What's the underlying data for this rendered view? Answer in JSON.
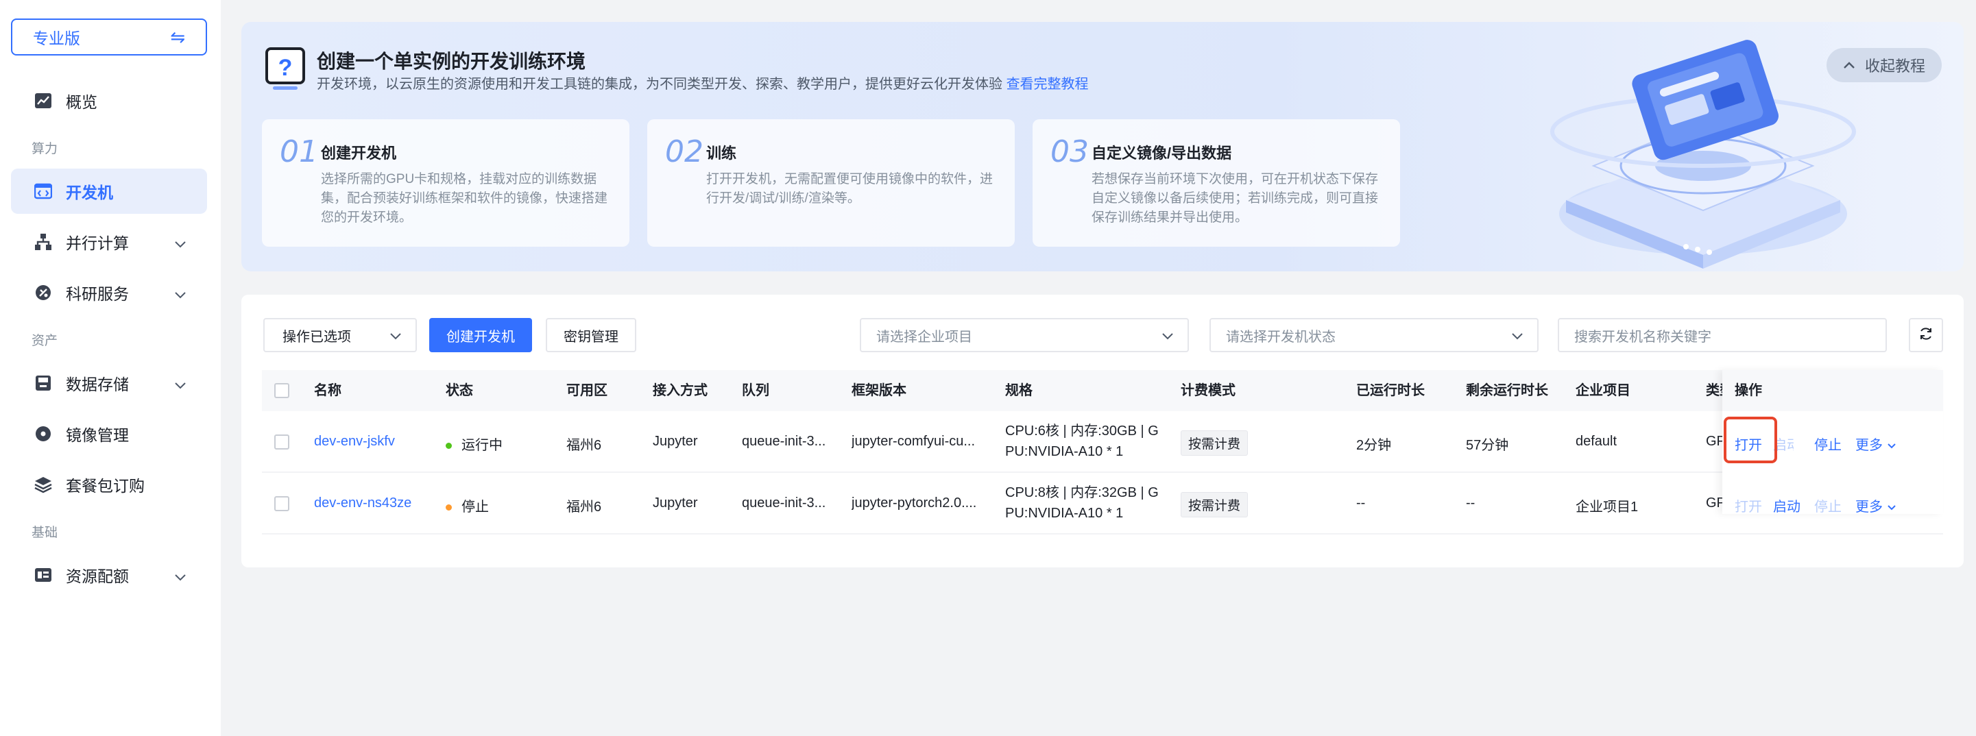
{
  "sidebar": {
    "edition_label": "专业版",
    "swap_icon": "⇋",
    "overview": "概览",
    "group_compute": "算力",
    "devbox": "开发机",
    "parallel": "并行计算",
    "research": "科研服务",
    "group_assets": "资产",
    "storage": "数据存储",
    "images": "镜像管理",
    "packages": "套餐包订购",
    "group_basic": "基础",
    "quota": "资源配额"
  },
  "banner": {
    "title": "创建一个单实例的开发训练环境",
    "desc": "开发环境，以云原生的资源使用和开发工具链的集成，为不同类型开发、探索、教学用户，提供更好云化开发体验",
    "link": "查看完整教程",
    "collapse": "收起教程",
    "steps": [
      {
        "num": "01",
        "title": "创建开发机",
        "desc": "选择所需的GPU卡和规格，挂载对应的训练数据集，配合预装好训练框架和软件的镜像，快速搭建您的开发环境。"
      },
      {
        "num": "02",
        "title": "训练",
        "desc": "打开开发机，无需配置便可使用镜像中的软件，进行开发/调试/训练/渲染等。"
      },
      {
        "num": "03",
        "title": "自定义镜像/导出数据",
        "desc": "若想保存当前环境下次使用，可在开机状态下保存自定义镜像以备后续使用；若训练完成，则可直接保存训练结果并导出使用。"
      }
    ]
  },
  "toolbar": {
    "bulk_ops": "操作已选项",
    "create": "创建开发机",
    "keys": "密钥管理",
    "project_placeholder": "请选择企业项目",
    "status_placeholder": "请选择开发机状态",
    "search_placeholder": "搜索开发机名称关键字"
  },
  "table": {
    "headers": {
      "name": "名称",
      "status": "状态",
      "zone": "可用区",
      "access": "接入方式",
      "queue": "队列",
      "framework": "框架版本",
      "spec": "规格",
      "billing": "计费模式",
      "runtime": "已运行时长",
      "remaining": "剩余运行时长",
      "project": "企业项目",
      "type": "类型",
      "ops": "操作"
    },
    "rows": [
      {
        "name": "dev-env-jskfv",
        "status": "运行中",
        "status_color": "#52c41a",
        "zone": "福州6",
        "access": "Jupyter",
        "queue": "queue-init-3...",
        "framework": "jupyter-comfyui-cu...",
        "spec_line1": "CPU:6核 | 内存:30GB | G",
        "spec_line2": "PU:NVIDIA-A10 * 1",
        "billing": "按需计费",
        "runtime": "2分钟",
        "remaining": "57分钟",
        "project": "default",
        "type": "GPU",
        "op_open": "打开",
        "op_start": "启动",
        "op_stop": "停止",
        "op_more": "更多"
      },
      {
        "name": "dev-env-ns43ze",
        "status": "停止",
        "status_color": "#ff9a2e",
        "zone": "福州6",
        "access": "Jupyter",
        "queue": "queue-init-3...",
        "framework": "jupyter-pytorch2.0....",
        "spec_line1": "CPU:8核 | 内存:32GB | G",
        "spec_line2": "PU:NVIDIA-A10 * 1",
        "billing": "按需计费",
        "runtime": "--",
        "remaining": "--",
        "project": "企业项目1",
        "type": "GPU",
        "op_open": "打开",
        "op_start": "启动",
        "op_stop": "停止",
        "op_more": "更多"
      }
    ]
  },
  "colors": {
    "primary": "#3370ff",
    "highlight": "#e8452c"
  }
}
